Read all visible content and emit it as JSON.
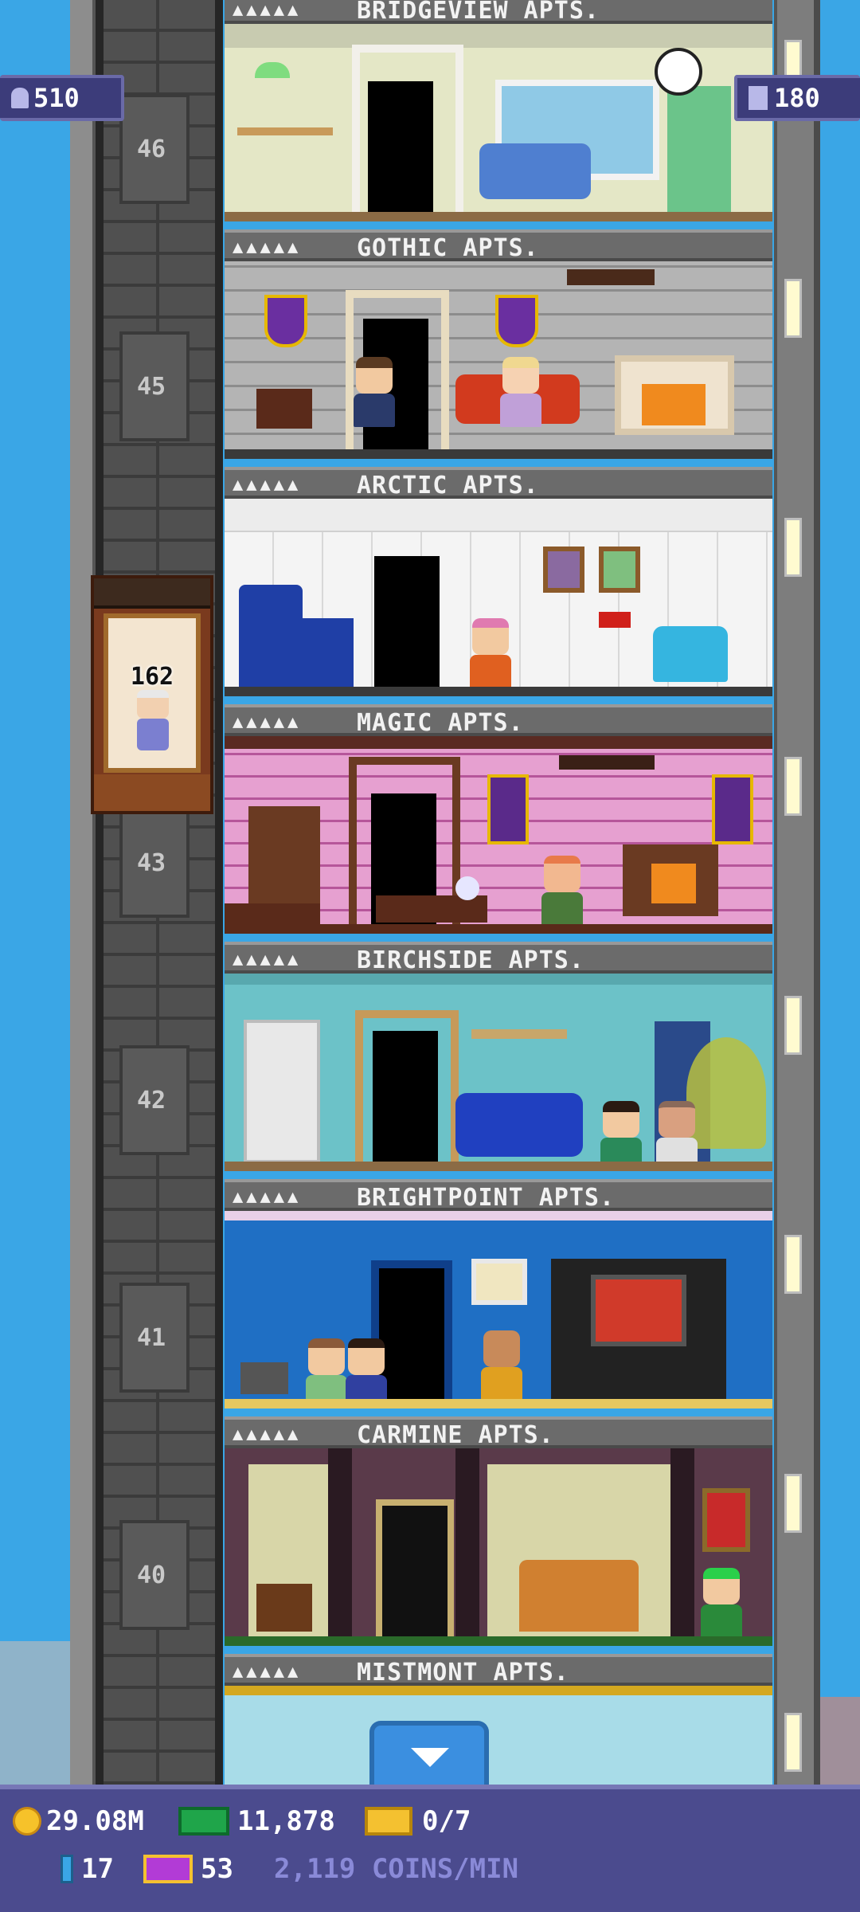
{
  "hud": {
    "population": "510",
    "floors": "180",
    "coins": "29.08M",
    "bux": "11,878",
    "tickets": "0/7",
    "blocks": "17",
    "vip": "53",
    "coins_per_min": "2,119 COINS/MIN"
  },
  "elevator": {
    "count": "162"
  },
  "floor_numbers": [
    "46",
    "45",
    "43",
    "42",
    "41",
    "40"
  ],
  "floors": [
    {
      "pips": "▲▲▲▲▲",
      "name": "BRIDGEVIEW APTS."
    },
    {
      "pips": "▲▲▲▲▲",
      "name": "GOTHIC APTS."
    },
    {
      "pips": "▲▲▲▲▲",
      "name": "ARCTIC APTS."
    },
    {
      "pips": "▲▲▲▲▲",
      "name": "MAGIC APTS."
    },
    {
      "pips": "▲▲▲▲▲",
      "name": "BIRCHSIDE APTS."
    },
    {
      "pips": "▲▲▲▲▲",
      "name": "BRIGHTPOINT APTS."
    },
    {
      "pips": "▲▲▲▲▲",
      "name": "CARMINE APTS."
    },
    {
      "pips": "▲▲▲▲▲",
      "name": "MISTMONT APTS."
    }
  ],
  "icons": {
    "population": "person-icon",
    "floors": "building-icon",
    "coins": "coin-icon",
    "bux": "bux-icon",
    "tickets": "ticket-icon",
    "blocks": "block-icon",
    "vip": "vip-icon",
    "scroll": "chevron-down-icon"
  }
}
